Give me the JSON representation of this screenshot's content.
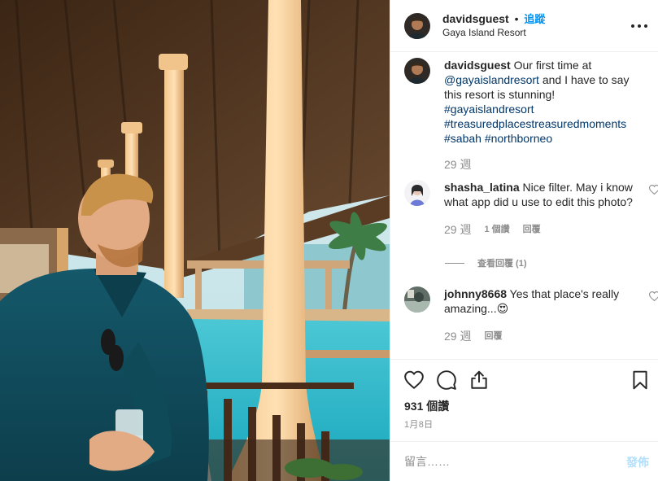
{
  "post": {
    "username": "davidsguest",
    "separator": "•",
    "follow_label": "追蹤",
    "location": "Gaya Island Resort",
    "more_icon": "more-horizontal-icon"
  },
  "caption": {
    "username": "davidsguest",
    "text_intro": "Our first time at ",
    "mention": "@gayaislandresort",
    "text_rest": " and I have to say this resort is stunning!",
    "hashtags": [
      "#gayaislandresort",
      "#treasuredplacestreasuredmoments",
      "#sabah",
      "#northborneo"
    ],
    "time": "29 週"
  },
  "comments": [
    {
      "username": "shasha_latina",
      "text": "Nice filter. May i know what app did u use to edit this photo?",
      "time": "29 週",
      "likes_label": "1 個讚",
      "reply_label": "回覆",
      "view_replies_label": "查看回覆 (1)"
    },
    {
      "username": "johnny8668",
      "text": "Yes that place's really amazing...",
      "emoji": "😍",
      "time": "29 週",
      "reply_label": "回覆"
    }
  ],
  "actions": {
    "icons": [
      "heart-icon",
      "comment-icon",
      "share-icon",
      "bookmark-icon"
    ]
  },
  "likes_label": "931 個讚",
  "date_label": "1月8日",
  "add_comment": {
    "placeholder": "留言……",
    "post_label": "發佈"
  },
  "colors": {
    "link": "#00376b",
    "follow": "#0095f6",
    "post_disabled": "#b2dffc",
    "secondary_text": "#8e8e8e"
  }
}
